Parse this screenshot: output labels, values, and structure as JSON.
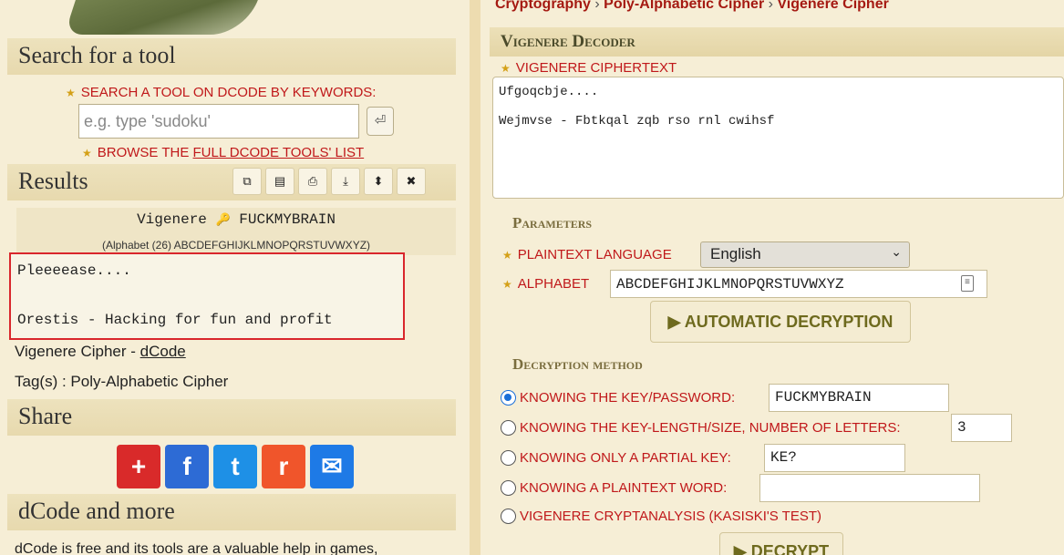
{
  "left": {
    "search_section": {
      "title": "Search for a tool",
      "keywords_label": "SEARCH A TOOL ON DCODE BY KEYWORDS:",
      "search_placeholder": "e.g. type 'sudoku'",
      "enter_icon": "⏎",
      "browse_prefix": "BROWSE THE ",
      "browse_link": "FULL DCODE TOOLS' LIST"
    },
    "results": {
      "title": "Results",
      "toolbar_icons": [
        "copy-icon",
        "save-icon",
        "print-icon",
        "download-icon",
        "pin-icon",
        "close-icon"
      ],
      "toolbar_glyphs": [
        "⧉",
        "▤",
        "⎙",
        "⤓",
        "⬍",
        "✖"
      ],
      "cipher_name": "Vigenere",
      "key_icon": "🔑",
      "key": "FUCKMYBRAIN",
      "alphabet_note": "(Alphabet (26) ABCDEFGHIJKLMNOPQRSTUVWXYZ)",
      "plaintext_line1": "Pleeeease....",
      "plaintext_line2": "Orestis - Hacking for fun and profit",
      "page_title_prefix": "Vigenere Cipher - ",
      "page_title_link": "dCode",
      "tags_line": "Tag(s) : Poly-Alphabetic Cipher"
    },
    "share": {
      "title": "Share",
      "buttons": [
        {
          "icon": "plus-icon",
          "glyph": "+",
          "color": "#d92a2a"
        },
        {
          "icon": "facebook-icon",
          "glyph": "f",
          "color": "#2d6bd5"
        },
        {
          "icon": "twitter-icon",
          "glyph": "t",
          "color": "#1e90e6"
        },
        {
          "icon": "reddit-icon",
          "glyph": "r",
          "color": "#f0552b"
        },
        {
          "icon": "mail-icon",
          "glyph": "✉",
          "color": "#1e7ae6"
        }
      ]
    },
    "more": {
      "title": "dCode and more",
      "text": "dCode is free and its tools are a valuable help in games,"
    }
  },
  "right": {
    "breadcrumb": {
      "item1": "Cryptography",
      "item2": "Poly-Alphabetic Cipher",
      "item3": "Vigenere Cipher",
      "sep": "›"
    },
    "panel_title": "Vigenere Decoder",
    "ciphertext_label": "VIGENERE CIPHERTEXT",
    "ciphertext": "Ufgoqcbje....\n\nWejmvse - Fbtkqal zqb rso rnl cwihsf",
    "parameters_title": "Parameters",
    "plaintext_language_label": "PLAINTEXT LANGUAGE",
    "language_selected": "English",
    "alphabet_label": "ALPHABET",
    "alphabet_value": "ABCDEFGHIJKLMNOPQRSTUVWXYZ",
    "auto_button": "▶ AUTOMATIC DECRYPTION",
    "method_title": "Decryption method",
    "methods": {
      "known_key_label": "KNOWING THE KEY/PASSWORD:",
      "known_key_value": "FUCKMYBRAIN",
      "key_length_label": "KNOWING THE KEY-LENGTH/SIZE, NUMBER OF LETTERS:",
      "key_length_value": "3",
      "partial_key_label": "KNOWING ONLY A PARTIAL KEY:",
      "partial_key_value": "KE?",
      "plaintext_word_label": "KNOWING A PLAINTEXT WORD:",
      "plaintext_word_value": "",
      "kasiski_label": "VIGENERE CRYPTANALYSIS (KASISKI'S TEST)"
    },
    "decrypt_button": "▶ DECRYPT"
  }
}
